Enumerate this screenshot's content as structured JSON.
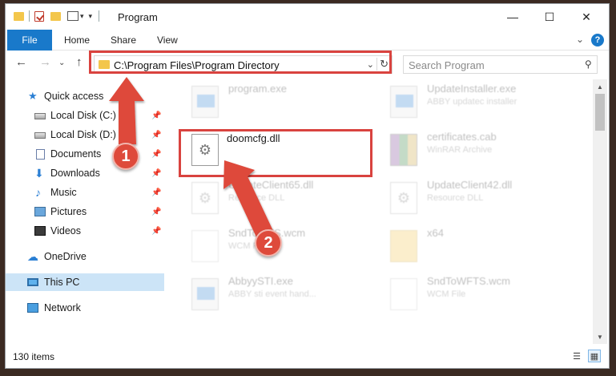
{
  "window": {
    "title": "Program",
    "controls": {
      "minimize": "—",
      "maximize": "☐",
      "close": "✕"
    }
  },
  "ribbon": {
    "file_tab": "File",
    "tabs": [
      "Home",
      "Share",
      "View"
    ],
    "expand_icon": "⌄",
    "help_label": "?"
  },
  "nav": {
    "back": "←",
    "forward": "→",
    "recent_dropdown": "⌄",
    "up": "↑",
    "address": "C:\\Program Files\\Program Directory",
    "address_dropdown": "⌄",
    "refresh": "↻",
    "search_placeholder": "Search Program",
    "search_glyph": "⚲"
  },
  "sidebar": {
    "items": [
      {
        "label": "Quick access",
        "icon": "star-icon"
      },
      {
        "label": "Local Disk (C:)",
        "icon": "drive-icon",
        "pinned": true
      },
      {
        "label": "Local Disk (D:)",
        "icon": "drive-icon",
        "pinned": true
      },
      {
        "label": "Documents",
        "icon": "documents-icon",
        "pinned": true
      },
      {
        "label": "Downloads",
        "icon": "download-icon",
        "pinned": true
      },
      {
        "label": "Music",
        "icon": "music-icon",
        "pinned": true
      },
      {
        "label": "Pictures",
        "icon": "pictures-icon",
        "pinned": true
      },
      {
        "label": "Videos",
        "icon": "videos-icon",
        "pinned": true
      },
      {
        "label": "OneDrive",
        "icon": "cloud-icon"
      },
      {
        "label": "This PC",
        "icon": "pc-icon",
        "selected": true
      },
      {
        "label": "Network",
        "icon": "network-icon"
      }
    ],
    "pin_glyph": "📌"
  },
  "files": [
    {
      "name": "program.exe",
      "type": "",
      "icon": "exe-icon"
    },
    {
      "name": "UpdateInstaller.exe",
      "type": "ABBY updatec installer",
      "icon": "exe-icon"
    },
    {
      "name": "doomcfg.dll",
      "type": "",
      "icon": "dll-icon",
      "focused": true
    },
    {
      "name": "certificates.cab",
      "type": "WinRAR Archive",
      "icon": "archive-icon"
    },
    {
      "name": "UpdateClient65.dll",
      "type": "Resource DLL",
      "icon": "dll-icon"
    },
    {
      "name": "UpdateClient42.dll",
      "type": "Resource DLL",
      "icon": "dll-icon"
    },
    {
      "name": "SndToWFS.wcm",
      "type": "WCM File",
      "icon": "file-icon"
    },
    {
      "name": "x64",
      "type": "",
      "icon": "folder-icon"
    },
    {
      "name": "AbbyySTI.exe",
      "type": "ABBY sti event hand...",
      "icon": "exe-icon"
    },
    {
      "name": "SndToWFTS.wcm",
      "type": "WCM File",
      "icon": "file-icon"
    }
  ],
  "status": {
    "item_count": "130 items"
  },
  "annotations": {
    "step1": "1",
    "step2": "2",
    "accent": "#de4a3b"
  }
}
